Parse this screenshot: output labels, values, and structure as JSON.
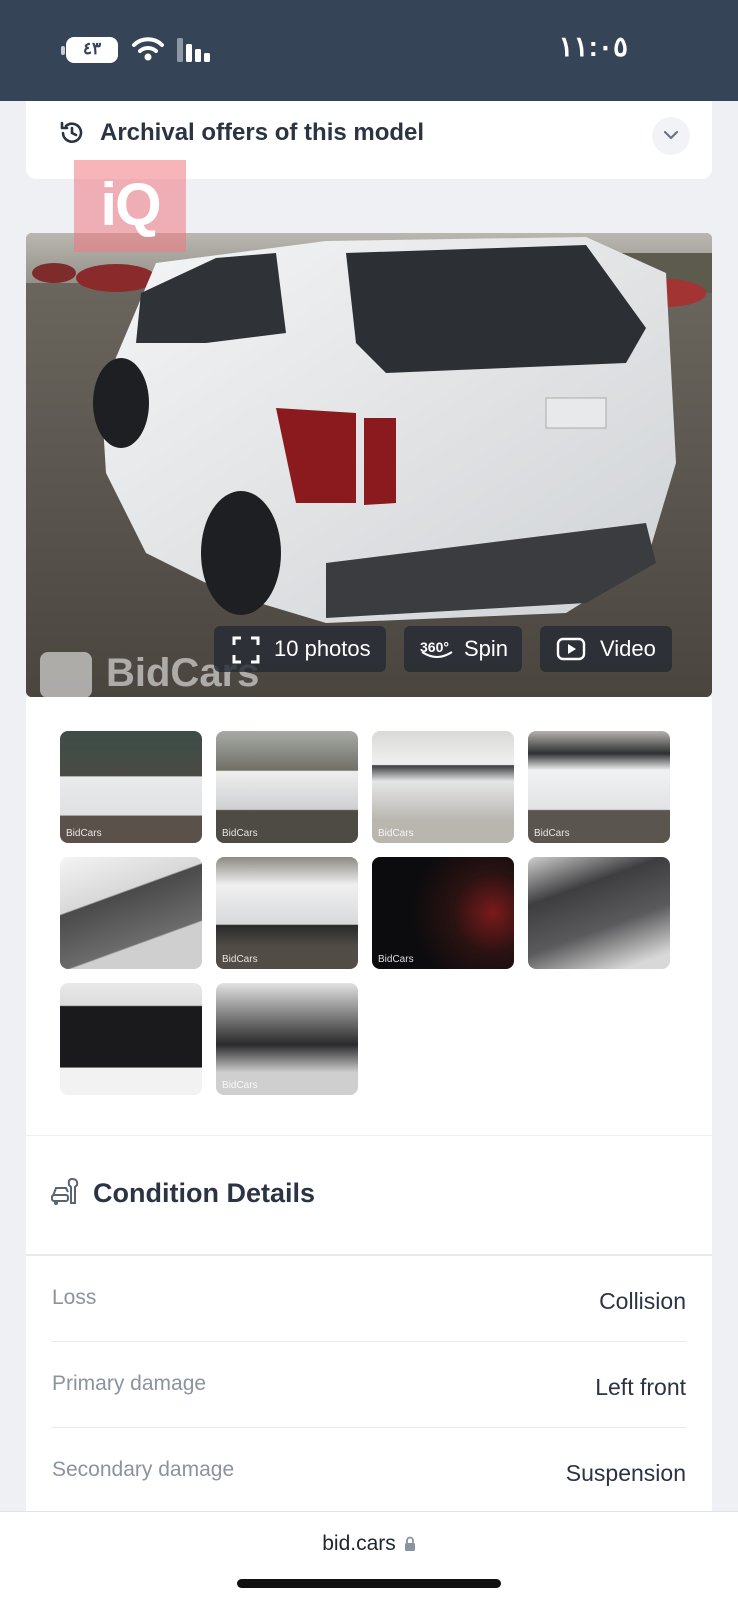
{
  "status_bar": {
    "time": "١١:٠٥",
    "battery_level": "٤٣"
  },
  "archival": {
    "title": "Archival offers of this model"
  },
  "watermark": {
    "iq": "iQ",
    "bidcars": "BidCars"
  },
  "gallery": {
    "photos_label": "10 photos",
    "spin_label": "Spin",
    "spin_badge": "360°",
    "video_label": "Video",
    "thumb_watermark": "BidCars"
  },
  "condition": {
    "title": "Condition Details",
    "rows": [
      {
        "label": "Loss",
        "value": "Collision"
      },
      {
        "label": "Primary damage",
        "value": "Left front"
      },
      {
        "label": "Secondary damage",
        "value": "Suspension"
      }
    ]
  },
  "browser": {
    "url": "bid.cars"
  },
  "colors": {
    "status_bar_bg": "#354457",
    "page_bg": "#eef0f3",
    "text_primary": "#2b3443",
    "text_muted": "#8b93a0"
  }
}
